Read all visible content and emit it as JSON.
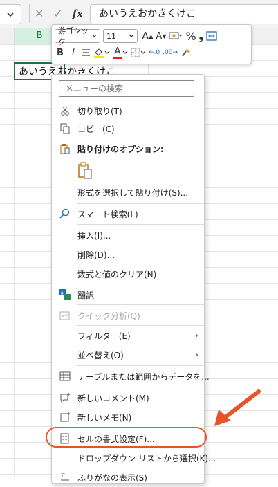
{
  "formula_bar": {
    "cancel_glyph": "✕",
    "enter_glyph": "✓",
    "fx_label": "fx",
    "value": "あいうえおかきくけこ"
  },
  "grid": {
    "selected_column": "B",
    "cell_value": "あいうえおかきくけこ"
  },
  "mini_toolbar": {
    "font_name": "游ゴシック",
    "font_size": "11",
    "grow_font": "A",
    "shrink_font": "A",
    "percent": "%",
    "comma": "❟",
    "bold": "B",
    "italic": "I",
    "font_color_letter": "A",
    "decrease_decimal": "←.0",
    "increase_decimal": ".00→"
  },
  "menu": {
    "search_placeholder": "メニューの検索",
    "items": [
      {
        "label": "切り取り(T)"
      },
      {
        "label": "コピー(C)"
      },
      {
        "label": "貼り付けのオプション:"
      },
      {
        "label": "形式を選択して貼り付け(S)..."
      },
      {
        "label": "スマート検索(L)"
      },
      {
        "label": "挿入(I)..."
      },
      {
        "label": "削除(D)..."
      },
      {
        "label": "数式と値のクリア(N)"
      },
      {
        "label": "翻訳"
      },
      {
        "label": "クイック分析(Q)"
      },
      {
        "label": "フィルター(E)"
      },
      {
        "label": "並べ替え(O)"
      },
      {
        "label": "テーブルまたは範囲からデータを..."
      },
      {
        "label": "新しいコメント(M)"
      },
      {
        "label": "新しいメモ(N)"
      },
      {
        "label": "セルの書式設定(F)..."
      },
      {
        "label": "ドロップダウン リストから選択(K)..."
      },
      {
        "label": "ふりがなの表示(S)"
      }
    ],
    "submenu_glyph": "›"
  },
  "colors": {
    "accent_green": "#1e7145",
    "highlight_orange": "#e8542a"
  }
}
